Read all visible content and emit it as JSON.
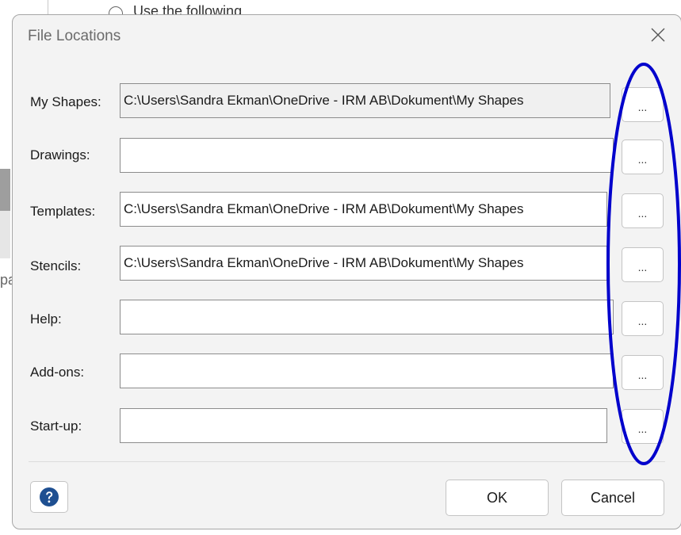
{
  "background": {
    "radio_text": "Use the following",
    "edge_letter": "pa"
  },
  "dialog": {
    "title": "File Locations",
    "close_icon": "close-icon",
    "rows": [
      {
        "label": "My Shapes:",
        "value": "C:\\Users\\Sandra Ekman\\OneDrive - IRM AB\\Dokument\\My Shapes",
        "browse": "..."
      },
      {
        "label": "Drawings:",
        "value": "",
        "browse": "..."
      },
      {
        "label": "Templates:",
        "value": "C:\\Users\\Sandra Ekman\\OneDrive - IRM AB\\Dokument\\My Shapes",
        "browse": "..."
      },
      {
        "label": "Stencils:",
        "value": "C:\\Users\\Sandra Ekman\\OneDrive - IRM AB\\Dokument\\My Shapes",
        "browse": "..."
      },
      {
        "label": "Help:",
        "value": "",
        "browse": "..."
      },
      {
        "label": "Add-ons:",
        "value": "",
        "browse": "..."
      },
      {
        "label": "Start-up:",
        "value": "",
        "browse": "..."
      }
    ],
    "help_icon": "question-circle-icon",
    "ok_label": "OK",
    "cancel_label": "Cancel"
  },
  "colors": {
    "annotation": "#0000cc",
    "help_icon": "#1e4f91"
  }
}
